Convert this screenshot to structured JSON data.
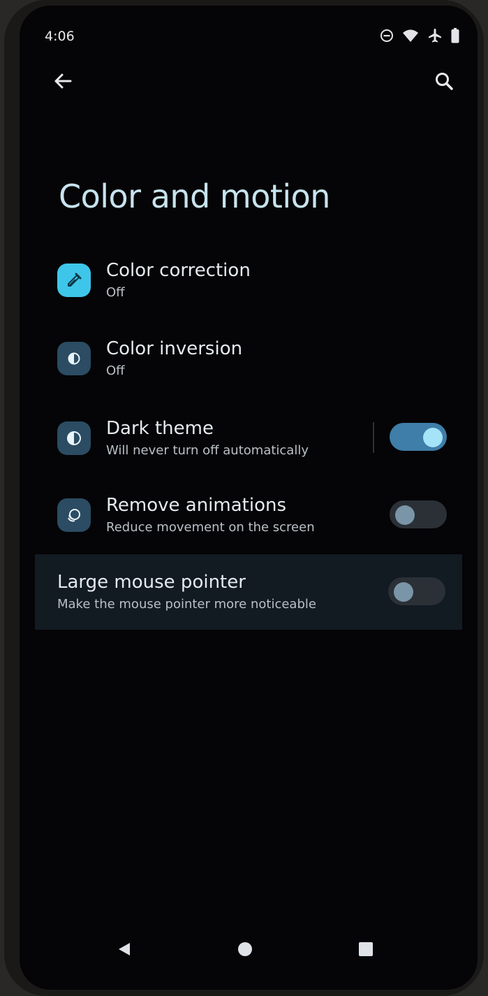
{
  "status_bar": {
    "time": "4:06",
    "icons": [
      "do-not-disturb-icon",
      "wifi-icon",
      "airplane-icon",
      "battery-icon"
    ]
  },
  "top_bar": {
    "back_icon": "arrow-back-icon",
    "search_icon": "search-icon"
  },
  "page": {
    "title": "Color and motion"
  },
  "settings": {
    "color_correction": {
      "title": "Color correction",
      "subtitle": "Off",
      "icon": "eyedropper-icon"
    },
    "color_inversion": {
      "title": "Color inversion",
      "subtitle": "Off",
      "icon": "invert-colors-icon"
    },
    "dark_theme": {
      "title": "Dark theme",
      "subtitle": "Will never turn off automatically",
      "icon": "dark-theme-icon",
      "enabled": true
    },
    "remove_animations": {
      "title": "Remove animations",
      "subtitle": "Reduce movement on the screen",
      "icon": "animation-icon",
      "enabled": false
    },
    "large_mouse_pointer": {
      "title": "Large mouse pointer",
      "subtitle": "Make the mouse pointer more noticeable",
      "enabled": false
    }
  },
  "nav_bar": {
    "back_icon": "nav-back-icon",
    "home_icon": "nav-home-icon",
    "recents_icon": "nav-recents-icon"
  },
  "colors": {
    "accent": "#3e7ea8",
    "title_text": "#c7e3ee",
    "background": "#050406",
    "color_correction_tile": "#3ec6ea",
    "icon_tile": "#2b4c63"
  }
}
